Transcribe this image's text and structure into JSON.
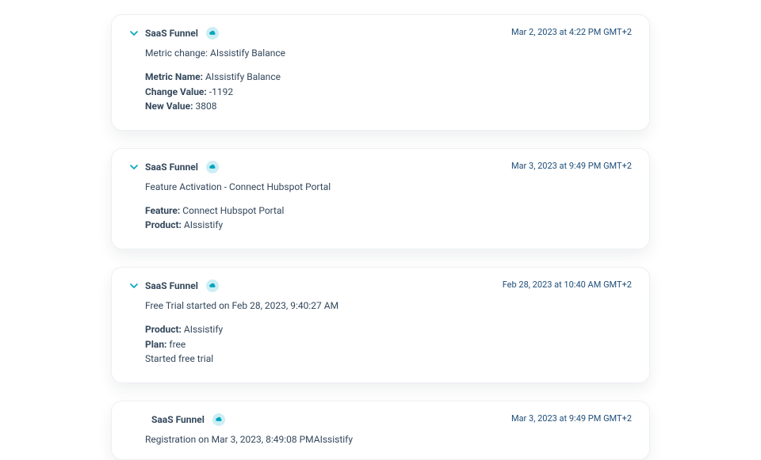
{
  "events": [
    {
      "source": "SaaS Funnel",
      "timestamp": "Mar 2, 2023 at 4:22 PM GMT+2",
      "subject": "Metric change: AIssistify Balance",
      "fields": [
        {
          "label": "Metric Name:",
          "value": " AIssistify Balance"
        },
        {
          "label": "Change Value:",
          "value": " -1192"
        },
        {
          "label": "New Value:",
          "value": " 3808"
        }
      ],
      "trailing": [],
      "hasChevron": true
    },
    {
      "source": "SaaS Funnel",
      "timestamp": "Mar 3, 2023 at 9:49 PM GMT+2",
      "subject": "Feature Activation - Connect Hubspot Portal",
      "fields": [
        {
          "label": "Feature:",
          "value": " Connect Hubspot Portal"
        },
        {
          "label": "Product:",
          "value": " AIssistify"
        }
      ],
      "trailing": [],
      "hasChevron": true
    },
    {
      "source": "SaaS Funnel",
      "timestamp": "Feb 28, 2023 at 10:40 AM GMT+2",
      "subject": "Free Trial started on Feb 28, 2023, 9:40:27 AM",
      "fields": [
        {
          "label": "Product:",
          "value": " AIssistify"
        },
        {
          "label": "Plan:",
          "value": " free"
        }
      ],
      "trailing": [
        "Started free trial"
      ],
      "hasChevron": true
    },
    {
      "source": "SaaS Funnel",
      "timestamp": "Mar 3, 2023 at 9:49 PM GMT+2",
      "subject": "Registration on Mar 3, 2023, 8:49:08 PMAIssistify",
      "fields": [],
      "trailing": [],
      "hasChevron": false
    }
  ]
}
